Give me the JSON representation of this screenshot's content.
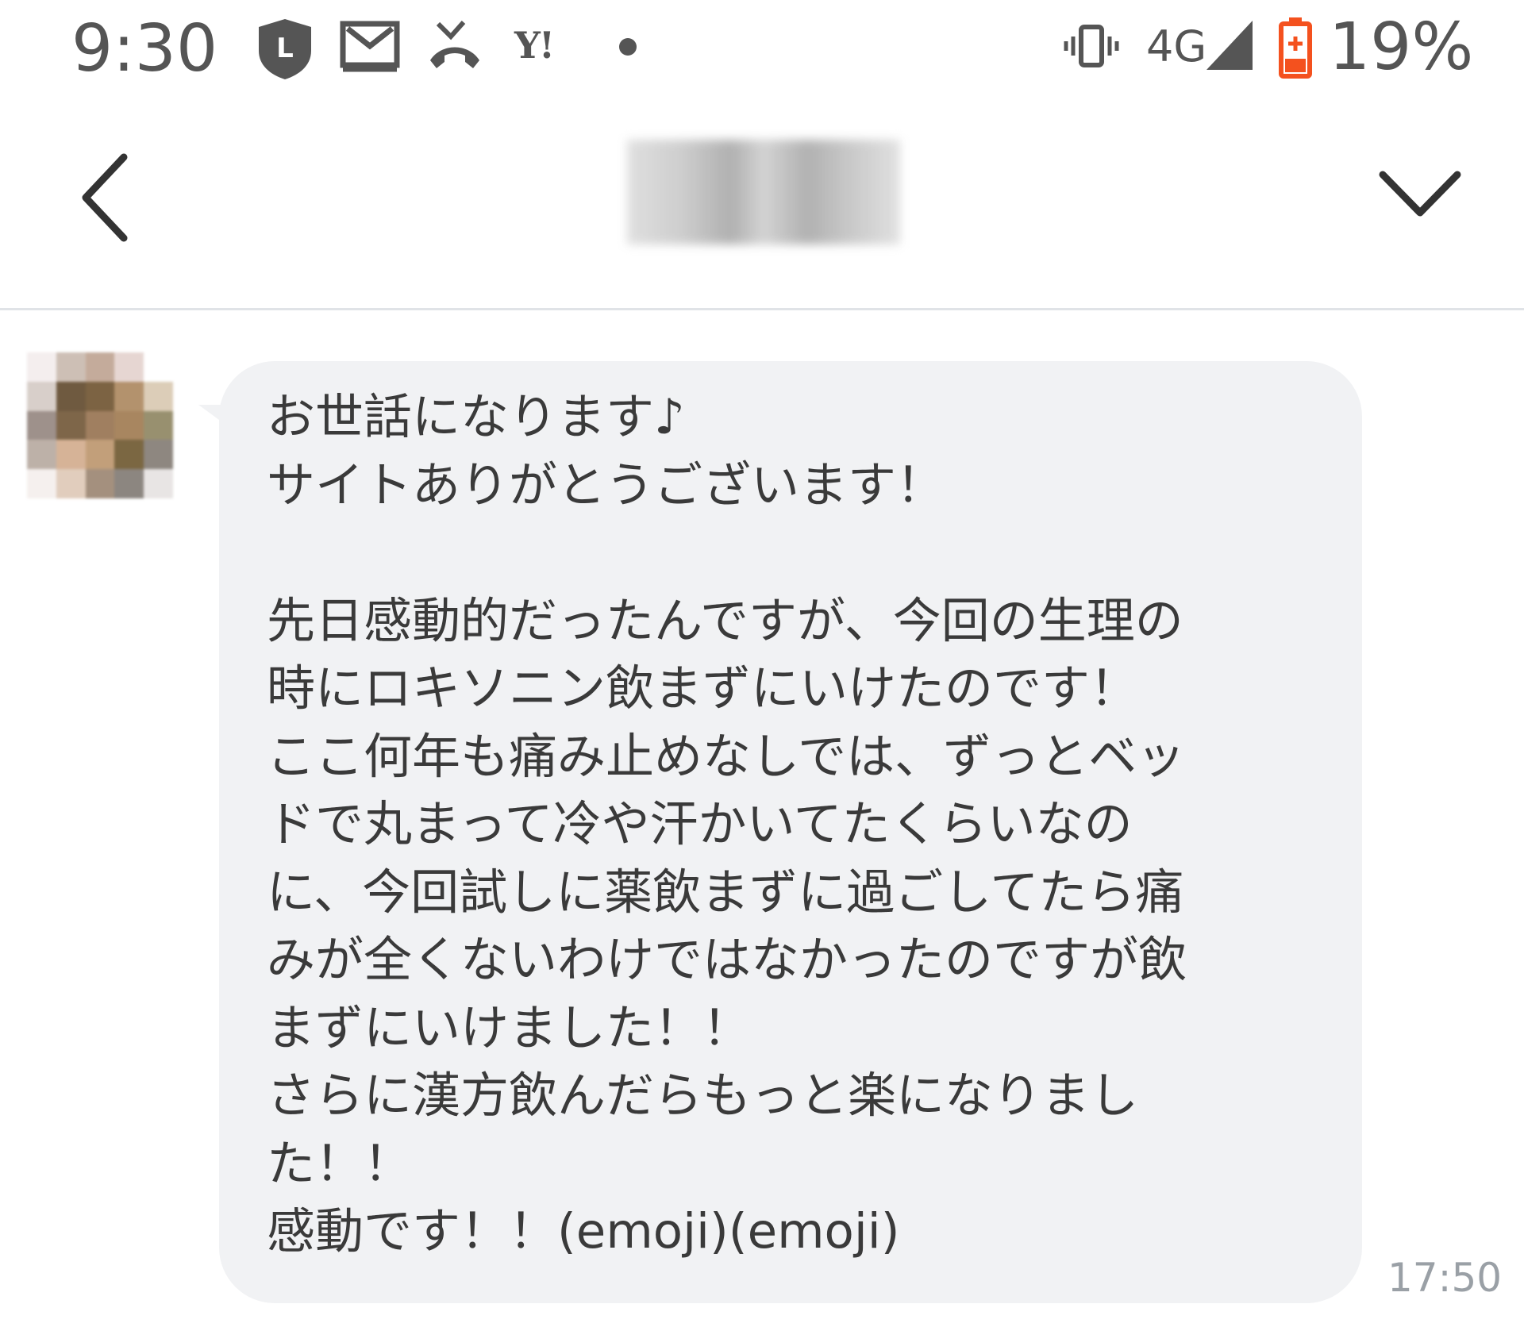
{
  "status_bar": {
    "time": "9:30",
    "notification_icons": [
      "line-icon",
      "mail-icon",
      "missed-call-icon",
      "yahoo-icon",
      "more-dot-icon"
    ],
    "yahoo_label": "Y!",
    "network": "4G",
    "battery": "19%",
    "battery_color": "#f4511e"
  },
  "header": {
    "back_icon": "chevron-left-icon",
    "menu_icon": "chevron-down-icon"
  },
  "message": {
    "text": "お世話になります♪\nサイトありがとうございます！\n\n先日感動的だったんですが、今回の生理の\n時にロキソニン飲まずにいけたのです！\nここ何年も痛み止めなしでは、ずっとベッ\nドで丸まって冷や汗かいてたくらいなの\nに、今回試しに薬飲まずに過ごしてたら痛\nみが全くないわけではなかったのですが飲\nまずにいけました！！\nさらに漢方飲んだらもっと楽になりまし\nた！！\n感動です！！(emoji)(emoji)",
    "time": "17:50",
    "bubble_color": "#f1f2f4"
  }
}
